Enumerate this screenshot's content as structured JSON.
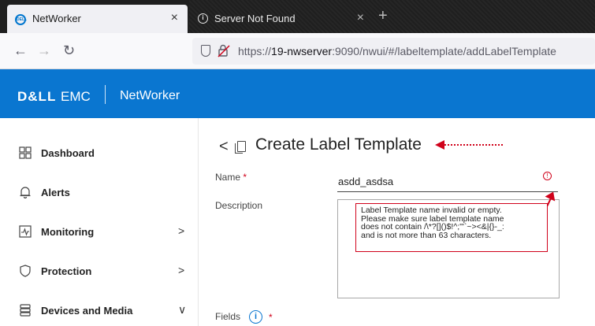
{
  "browser": {
    "tabs": [
      {
        "title": "NetWorker",
        "favicon": "dell-emc-logo",
        "active": true
      },
      {
        "title": "Server Not Found",
        "favicon": "info-icon",
        "active": false
      }
    ],
    "new_tab_symbol": "+",
    "close_symbol": "×",
    "url": {
      "prefix": "https://",
      "host": "19-nwserver",
      "rest": ":9090/nwui/#/labeltemplate/addLabelTemplate"
    }
  },
  "header": {
    "brand_dell": "D&LL",
    "brand_emc": "EMC",
    "product": "NetWorker",
    "color": "#0a76d0"
  },
  "sidebar": {
    "items": [
      {
        "label": "Dashboard",
        "icon": "grid-icon",
        "has_chevron": false
      },
      {
        "label": "Alerts",
        "icon": "bell-icon",
        "has_chevron": false
      },
      {
        "label": "Monitoring",
        "icon": "monitor-icon",
        "has_chevron": true,
        "chevron": ">"
      },
      {
        "label": "Protection",
        "icon": "shield-icon",
        "has_chevron": true,
        "chevron": ">"
      },
      {
        "label": "Devices and Media",
        "icon": "database-icon",
        "has_chevron": true,
        "chevron": "∨"
      }
    ]
  },
  "main": {
    "back_symbol": "<",
    "title": "Create Label Template",
    "form": {
      "name_label": "Name",
      "name_required": "*",
      "name_value": "asdd_asdsa",
      "description_label": "Description",
      "description_value": "",
      "fields_label": "Fields",
      "fields_required": "*"
    },
    "error_tooltip": {
      "lines": [
        "Label Template name invalid or empty.",
        "Please make sure label template name",
        "does not contain /\\*?[]()$!^;'\"`~><&|{}-_:",
        "and is not more than 63 characters."
      ]
    }
  },
  "colors": {
    "error": "#d0021b",
    "accent": "#0a76d0"
  }
}
